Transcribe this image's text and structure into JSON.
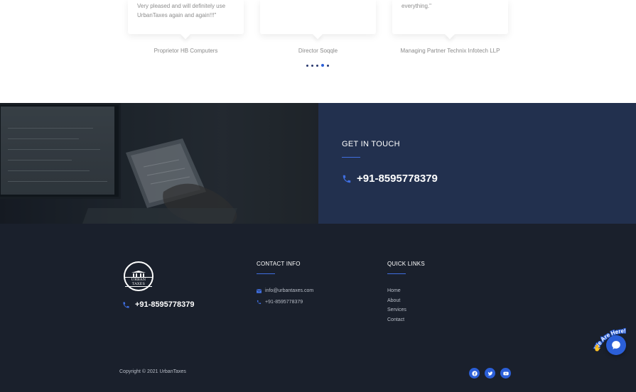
{
  "testimonials": {
    "items": [
      {
        "quote": "Very pleased and will definitely use UrbanTaxes again and again!!!\"",
        "author": "Proprietor HB Computers"
      },
      {
        "quote": "",
        "author": "Director Soqqle"
      },
      {
        "quote": "everything.\"",
        "author": "Managing Partner Technix Infotech LLP"
      }
    ],
    "dots_count": 5,
    "active_dot": 4
  },
  "get_in_touch": {
    "title": "GET IN TOUCH",
    "phone": "+91-8595778379"
  },
  "footer": {
    "logo_text": "URBAN TAXES",
    "phone": "+91-8595778379",
    "contact_info": {
      "title": "CONTACT INFO",
      "email": "info@urbantaxes.com",
      "phone": "+91-8595778379"
    },
    "quick_links": {
      "title": "QUICK LINKS",
      "items": [
        "Home",
        "About",
        "Services",
        "Contact"
      ]
    },
    "copyright": "Copyright © 2021 UrbanTaxes",
    "social": [
      "facebook-icon",
      "twitter-icon",
      "youtube-icon"
    ]
  },
  "chat_widget": {
    "badge_text": "We Are Here!"
  },
  "colors": {
    "accent": "#2b5fd8",
    "touch_panel": "#22304e",
    "footer_bg": "#1a202c"
  }
}
